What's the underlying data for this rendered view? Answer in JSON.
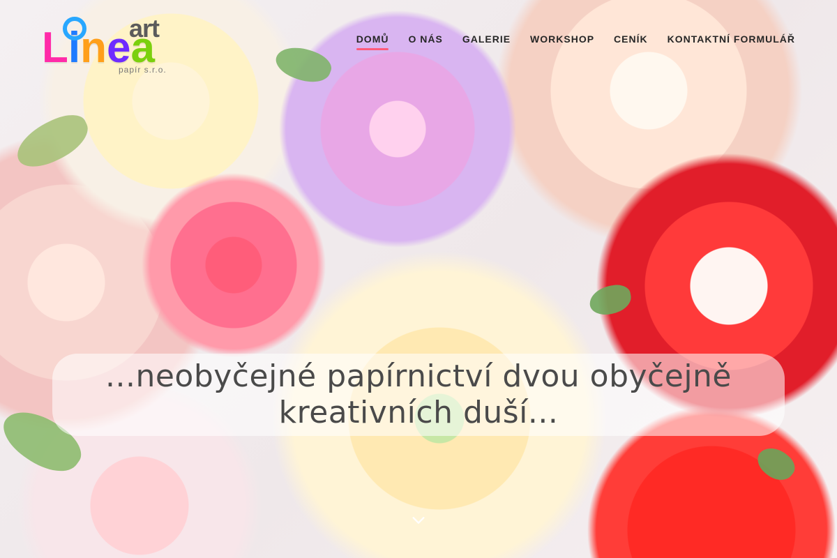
{
  "header": {
    "logo": {
      "top_word": "art",
      "main_word": "Linea",
      "sub_text": "papír s.r.o."
    },
    "nav": {
      "items": [
        {
          "label": "DOMŮ",
          "active": true
        },
        {
          "label": "O NÁS",
          "active": false
        },
        {
          "label": "GALERIE",
          "active": false
        },
        {
          "label": "WORKSHOP",
          "active": false
        },
        {
          "label": "CENÍK",
          "active": false
        },
        {
          "label": "KONTAKTNÍ FORMULÁŘ",
          "active": false
        }
      ]
    }
  },
  "hero": {
    "tagline": "...neobyčejné papírnictví dvou obyčejně kreativních duší...",
    "scroll_icon": "chevron-down-icon"
  },
  "colors": {
    "nav_active_underline": "#ff5b7a",
    "text_dark": "#262626",
    "tagline_text": "#4a4a4a"
  }
}
